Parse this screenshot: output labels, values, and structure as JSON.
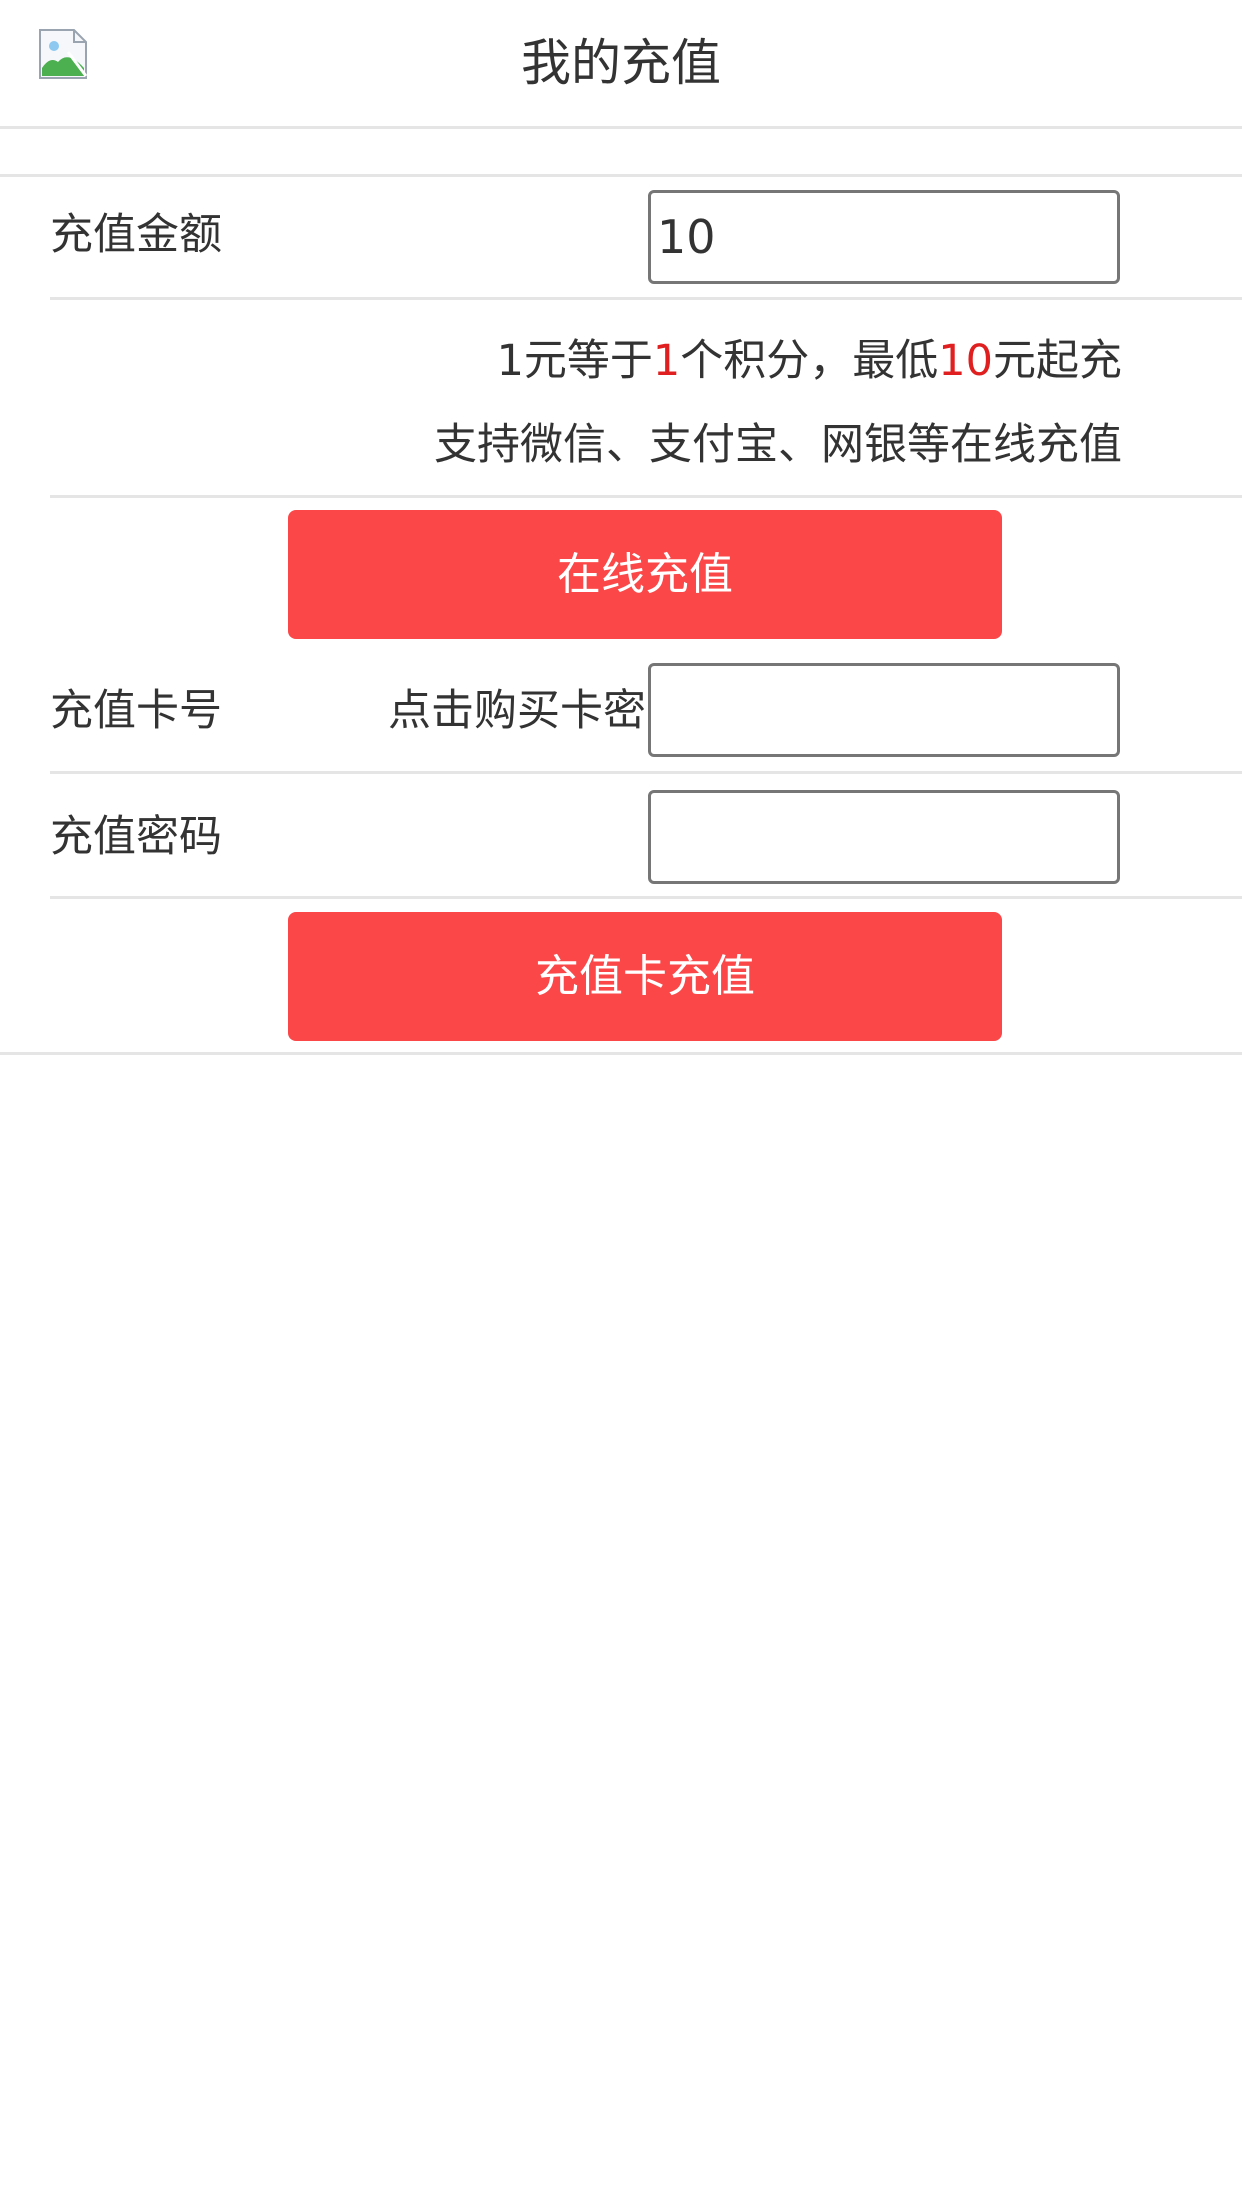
{
  "header": {
    "title": "我的充值",
    "back_icon": "broken-image-icon"
  },
  "amount_row": {
    "label": "充值金额",
    "value": "10"
  },
  "info": {
    "line1_prefix": "1元等于",
    "line1_points": "1",
    "line1_middle": "个积分，最低",
    "line1_min": "10",
    "line1_suffix": "元起充",
    "line2": "支持微信、支付宝、网银等在线充值"
  },
  "online_button": {
    "label": "在线充值"
  },
  "card_number_row": {
    "label": "充值卡号",
    "buy_link": "点击购买卡密",
    "value": ""
  },
  "card_password_row": {
    "label": "充值密码",
    "value": ""
  },
  "card_button": {
    "label": "充值卡充值"
  },
  "colors": {
    "accent": "#fb4748",
    "highlight": "#e02020",
    "divider": "#e5e5e5"
  }
}
